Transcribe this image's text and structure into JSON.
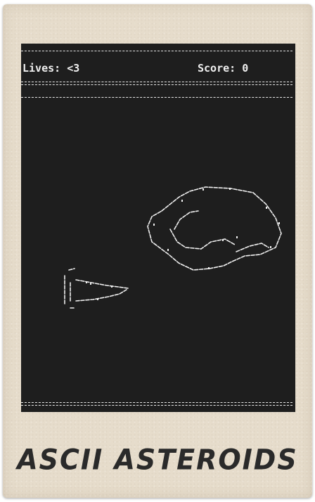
{
  "hud": {
    "lives_label": "Lives: <3",
    "score_label": "Score: 0"
  },
  "caption": "ASCII ASTEROIDS",
  "colors": {
    "frame": "#e6dccb",
    "screen": "#1e1e1e",
    "ascii": "#f0f0f0",
    "caption": "#2a2a2a"
  },
  "sprites": {
    "ship": "ship-icon",
    "asteroid": "asteroid-icon"
  }
}
